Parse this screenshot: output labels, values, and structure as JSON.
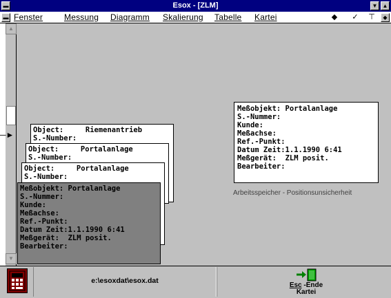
{
  "window": {
    "title": "Esox - [ZLM]"
  },
  "menu": {
    "items": [
      "Fenster",
      "Messung",
      "Diagramm",
      "Skalierung",
      "Tabelle",
      "Kartei"
    ]
  },
  "cards": [
    {
      "rows": [
        {
          "label": "Object:",
          "value": "Riemenantrieb"
        },
        {
          "label": "S.-Number:",
          "value": ""
        }
      ]
    },
    {
      "rows": [
        {
          "label": "Object:",
          "value": "Portalanlage"
        },
        {
          "label": "S.-Number:",
          "value": ""
        }
      ]
    },
    {
      "rows": [
        {
          "label": "Object:",
          "value": "Portalanlage"
        },
        {
          "label": "S.-Number:",
          "value": ""
        }
      ]
    },
    {
      "rows": [
        {
          "label": "Meßobjekt:",
          "value": "Portalanlage"
        },
        {
          "label": "S.-Nummer:",
          "value": ""
        },
        {
          "label": "Kunde:",
          "value": ""
        },
        {
          "label": "Meßachse:",
          "value": ""
        },
        {
          "label": "Ref.-Punkt:",
          "value": ""
        },
        {
          "label": "Datum Zeit:",
          "value": "1.1.1990   6:41"
        },
        {
          "label": "Meßgerät:",
          "value": "ZLM posit."
        },
        {
          "label": "Bearbeiter:",
          "value": ""
        }
      ]
    }
  ],
  "detail_card": {
    "rows": [
      {
        "label": "Meßobjekt:",
        "value": "Portalanlage"
      },
      {
        "label": "S.-Nummer:",
        "value": ""
      },
      {
        "label": "Kunde:",
        "value": ""
      },
      {
        "label": "Meßachse:",
        "value": ""
      },
      {
        "label": "Ref.-Punkt:",
        "value": ""
      },
      {
        "label": "Datum Zeit:",
        "value": "1.1.1990   6:41"
      },
      {
        "label": "Meßgerät:",
        "value": "ZLM posit."
      },
      {
        "label": "Bearbeiter:",
        "value": ""
      }
    ]
  },
  "info_text": "Arbeitsspeicher - Positionsunsicherheit",
  "status": {
    "path": "e:\\esoxdat\\esox.dat",
    "esc_key": "Esc",
    "esc_rest": " -Ende",
    "esc_line2": "Kartei"
  },
  "colors": {
    "titlebar": "#000080",
    "client": "#c0c0c0",
    "gray_card": "#808080",
    "app_icon": "#800000"
  },
  "icons": {
    "tools": [
      "eraser-icon",
      "checkmark-icon",
      "pin-icon"
    ],
    "esc": "exit-door-icon"
  }
}
